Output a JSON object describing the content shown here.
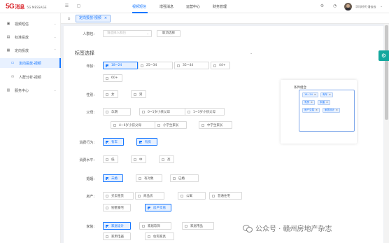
{
  "header": {
    "logo_5g": "5G",
    "logo_cn": "消息",
    "logo_en": "5G MESSAGE",
    "nav": [
      "视频短信",
      "增强消息",
      "运营中心",
      "财务管理"
    ],
    "active_nav": "视频短信",
    "username": "华讯时代-潘云云",
    "icons": [
      "menu-icon",
      "fullscreen-icon",
      "settings-icon",
      "notification-bell-icon",
      "chevron-down-icon"
    ]
  },
  "sidebar": {
    "items": [
      {
        "label": "视频短信",
        "icon": "video-icon",
        "level": 1,
        "arrow": "⌄"
      },
      {
        "label": "标准投放",
        "icon": "standard-delivery-icon",
        "level": 1,
        "arrow": "⌄"
      },
      {
        "label": "定向投放",
        "icon": "targeted-delivery-icon",
        "level": 1,
        "arrow": "⌃"
      },
      {
        "label": "定向投放-视频",
        "icon": "targeted-video-icon",
        "level": 2,
        "active": true
      },
      {
        "label": "人群分析-视频",
        "icon": "crowd-analysis-icon",
        "level": 2
      },
      {
        "label": "服务中心",
        "icon": "service-icon",
        "level": 1,
        "arrow": "⌄"
      }
    ]
  },
  "tabs": [
    {
      "label": "定向投放-视频",
      "close": "×"
    }
  ],
  "form": {
    "crowd_label": "人群包:",
    "crowd_placeholder": "请选择人群包",
    "cancel_label": "取消选择",
    "section_title": "标签选择",
    "collapse_glyph": "⌄"
  },
  "tag_groups": [
    {
      "label": "年龄:",
      "options": [
        {
          "text": "18~24",
          "checked": true
        },
        {
          "text": "25~34",
          "checked": false
        },
        {
          "text": "35~44",
          "checked": false
        },
        {
          "text": "44+",
          "checked": false
        },
        {
          "text": "60+",
          "checked": false
        }
      ]
    },
    {
      "label": "性别:",
      "options": [
        {
          "text": "女",
          "checked": false
        },
        {
          "text": "男",
          "checked": false
        }
      ]
    },
    {
      "label": "父母:",
      "options": [
        {
          "text": "孕期",
          "checked": false
        },
        {
          "text": "0~1岁小孩父母",
          "checked": false
        },
        {
          "text": "1~3岁小孩父母",
          "checked": false
        },
        {
          "text": "4~6岁小孩父母",
          "checked": false
        },
        {
          "text": "小学生家长",
          "checked": false
        },
        {
          "text": "中学生家长",
          "checked": false
        }
      ]
    },
    {
      "label": "消费行为:",
      "options": [
        {
          "text": "有车",
          "checked": true
        },
        {
          "text": "有房",
          "checked": true
        }
      ]
    },
    {
      "label": "消费水平:",
      "options": [
        {
          "text": "低",
          "checked": false
        },
        {
          "text": "中",
          "checked": false
        },
        {
          "text": "高",
          "checked": false
        }
      ]
    },
    {
      "label": "婚姻:",
      "options": [
        {
          "text": "未婚",
          "checked": true
        },
        {
          "text": "有对象",
          "checked": false
        },
        {
          "text": "已婚",
          "checked": false
        }
      ]
    },
    {
      "label": "房产:",
      "options": [
        {
          "text": "买卖租赁",
          "checked": false
        },
        {
          "text": "商品房",
          "checked": false
        },
        {
          "text": "公寓",
          "checked": false
        },
        {
          "text": "普通住宅",
          "checked": false
        },
        {
          "text": "别墅豪宅",
          "checked": false
        },
        {
          "text": "房产交易",
          "checked": true
        }
      ]
    },
    {
      "label": "家装:",
      "options": [
        {
          "text": "家居设计",
          "checked": true
        },
        {
          "text": "家居软饰",
          "checked": false
        },
        {
          "text": "家居用品",
          "checked": false
        },
        {
          "text": "家用电器",
          "checked": false
        },
        {
          "text": "住宅家具",
          "checked": false
        }
      ]
    }
  ],
  "summary": {
    "title": "条件组合",
    "chips": [
      "18~24",
      "有车",
      "有房",
      "未婚",
      "房产交易",
      "家居设计"
    ]
  },
  "watermark": "公众号 · 赣州房地产杂志"
}
